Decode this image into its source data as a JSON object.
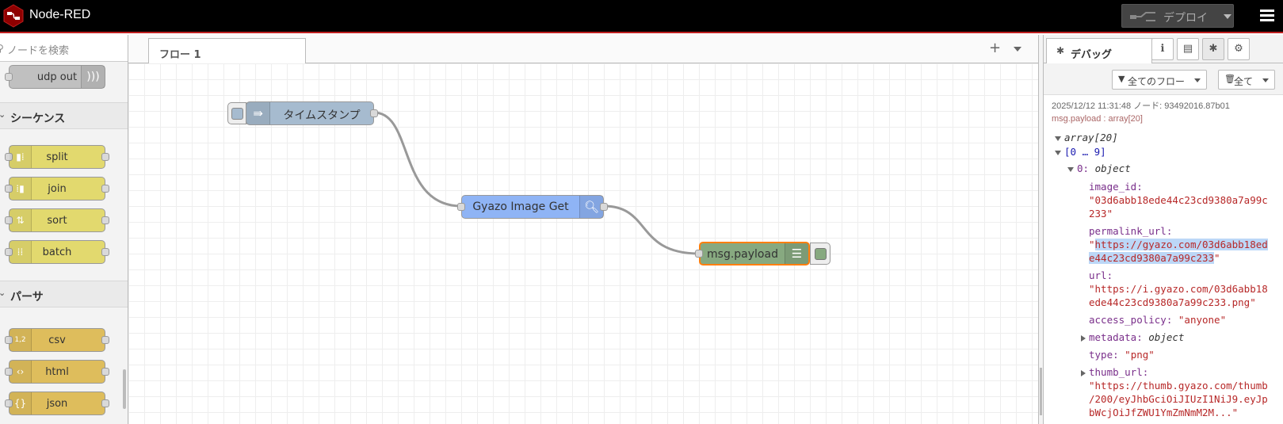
{
  "header": {
    "title": "Node-RED",
    "deploy_label": "デプロイ"
  },
  "palette": {
    "search_placeholder": "ノードを検索",
    "categories": [
      {
        "label": "シーケンス"
      },
      {
        "label": "パーサ"
      }
    ],
    "nodes": [
      {
        "label": "udp out",
        "color": "#c0c0c0"
      },
      {
        "label": "split",
        "color": "#e2d96e"
      },
      {
        "label": "join",
        "color": "#e2d96e"
      },
      {
        "label": "sort",
        "color": "#e2d96e"
      },
      {
        "label": "batch",
        "color": "#e2d96e"
      },
      {
        "label": "csv",
        "color": "#debd5c"
      },
      {
        "label": "html",
        "color": "#debd5c"
      },
      {
        "label": "json",
        "color": "#debd5c"
      }
    ]
  },
  "workspace": {
    "tab_label": "フロー 1",
    "nodes": [
      {
        "label": "タイムスタンプ",
        "color": "#a6bbcf"
      },
      {
        "label": "Gyazo Image Get",
        "color": "#8fb4f5"
      },
      {
        "label": "msg.payload",
        "color": "#87a980"
      }
    ]
  },
  "sidebar": {
    "debug_tab_label": "デバッグ",
    "filter_label": "全てのフロー",
    "clear_label": "全て",
    "message": {
      "meta": "2025/12/12 11:31:48 ノード: 93492016.87b01",
      "topic": "msg.payload : array[20]",
      "tree": {
        "root": "array[20]",
        "range": "[0 … 9]",
        "item_index": "0:",
        "item_type": "object",
        "image_id_key": "image_id:",
        "image_id_line1": "\"03d6abb18ede44c23cd9380a7a99c",
        "image_id_line2": "233\"",
        "permalink_key": "permalink_url:",
        "permalink_quote_open": "\"",
        "permalink_line1": "https://gyazo.com/03d6abb18ed",
        "permalink_line2": "e44c23cd9380a7a99c233",
        "permalink_quote_close": "\"",
        "url_key": "url:",
        "url_line1": "\"https://i.gyazo.com/03d6abb18",
        "url_line2": "ede44c23cd9380a7a99c233.png\"",
        "access_key": "access_policy:",
        "access_val": "\"anyone\"",
        "metadata_key": "metadata:",
        "metadata_type": "object",
        "type_key": "type:",
        "type_val": "\"png\"",
        "thumb_key": "thumb_url:",
        "thumb_line1": "\"https://thumb.gyazo.com/thumb",
        "thumb_line2": "/200/eyJhbGciOiJIUzI1NiJ9.eyJp",
        "thumb_line3": "bWcjOiJfZWU1YmZmNmM2M...\""
      }
    }
  }
}
